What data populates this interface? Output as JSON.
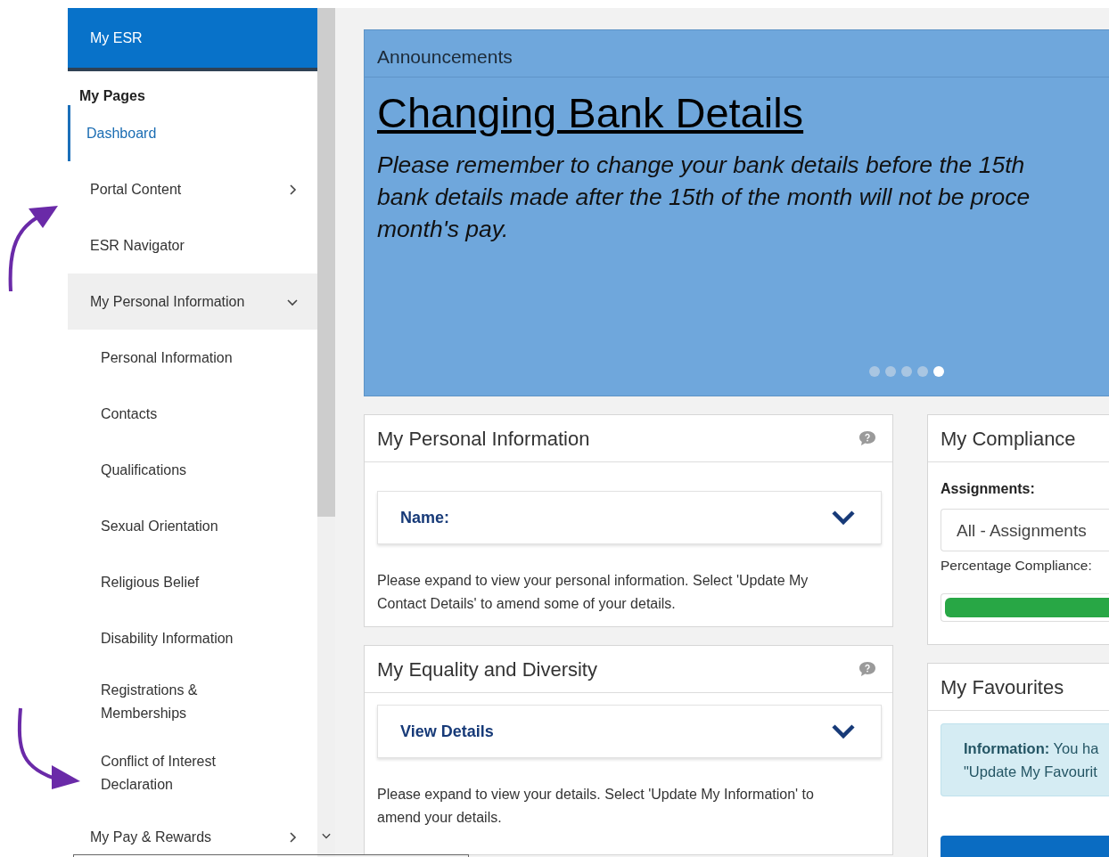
{
  "sidebar": {
    "header": "My ESR",
    "section": "My Pages",
    "items": [
      {
        "label": "Dashboard",
        "selected": true
      },
      {
        "label": "Portal Content",
        "selected": false,
        "expanded": false
      },
      {
        "label": "ESR Navigator",
        "selected": false
      },
      {
        "label": "My Personal Information",
        "selected": false,
        "expanded": true,
        "children": [
          {
            "label": "Personal Information",
            "selected": false
          },
          {
            "label": "Contacts",
            "selected": false
          },
          {
            "label": "Qualifications",
            "selected": false
          },
          {
            "label": "Sexual Orientation",
            "selected": false
          },
          {
            "label": "Religious Belief",
            "selected": false
          },
          {
            "label": "Disability Information",
            "selected": false
          },
          {
            "label": "Registrations & Memberships",
            "selected": false
          },
          {
            "label": "Conflict of Interest Declaration",
            "selected": false
          }
        ]
      },
      {
        "label": "My Pay & Rewards",
        "selected": false,
        "expanded": false
      }
    ]
  },
  "announcements": {
    "title": "Announcements",
    "heading": "Changing Bank Details",
    "lines": [
      "Please remember to change your bank details before the 15th",
      "bank details made after the 15th of the month will not be proce",
      "month's pay."
    ],
    "slides": [
      {
        "selected": false
      },
      {
        "selected": false
      },
      {
        "selected": false
      },
      {
        "selected": false
      },
      {
        "selected": true
      }
    ]
  },
  "left_cards": [
    {
      "title": "My Personal Information",
      "toggle": "Name:",
      "text": "Please expand to view your personal information. Select 'Update My Contact Details' to amend some of your details."
    },
    {
      "title": "My Equality and Diversity",
      "toggle": "View Details",
      "text": "Please expand to view your details. Select 'Update My Information' to amend your details."
    }
  ],
  "compliance": {
    "title": "My Compliance",
    "label": "Assignments:",
    "select_value": "All - Assignments",
    "percentage_label": "Percentage Compliance:",
    "level": 1
  },
  "favourites": {
    "title": "My Favourites",
    "info_lines": [
      "**Information:** You ha",
      "\"Update My Favourit"
    ]
  }
}
